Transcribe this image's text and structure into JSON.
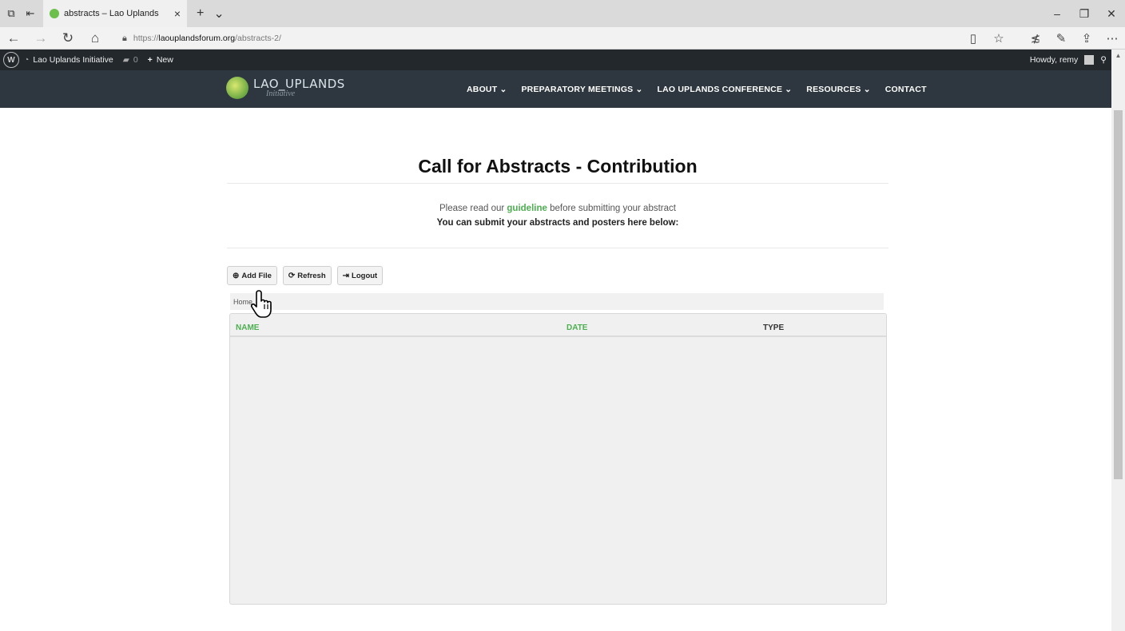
{
  "browser": {
    "tab_title": "abstracts – Lao Uplands",
    "url_prefix": "https://",
    "url_domain": "laouplandsforum.org",
    "url_path": "/abstracts-2/"
  },
  "adminbar": {
    "site_name": "Lao Uplands Initiative",
    "comments_count": "0",
    "new_label": "New",
    "howdy": "Howdy, remy"
  },
  "header": {
    "logo_line1": "LAO_UPLANDS",
    "logo_line2": "Initiative",
    "menu": [
      {
        "label": "ABOUT ⌄"
      },
      {
        "label": "PREPARATORY MEETINGS ⌄"
      },
      {
        "label": "LAO UPLANDS CONFERENCE ⌄"
      },
      {
        "label": "RESOURCES ⌄"
      },
      {
        "label": "CONTACT"
      }
    ]
  },
  "main": {
    "title": "Call for Abstracts - Contribution",
    "intro_before": "Please read our ",
    "intro_link": "guideline",
    "intro_after": " before submitting your abstract",
    "intro_bold": "You can submit your abstracts and posters here below:",
    "buttons": {
      "add_file": "Add File",
      "refresh": "Refresh",
      "logout": "Logout"
    },
    "breadcrumb": "Home",
    "table": {
      "columns": [
        "NAME",
        "DATE",
        "TYPE"
      ],
      "rows": []
    }
  },
  "colors": {
    "accent_green": "#4caf50",
    "header_bg": "#2e3740",
    "adminbar_bg": "#23282d"
  }
}
